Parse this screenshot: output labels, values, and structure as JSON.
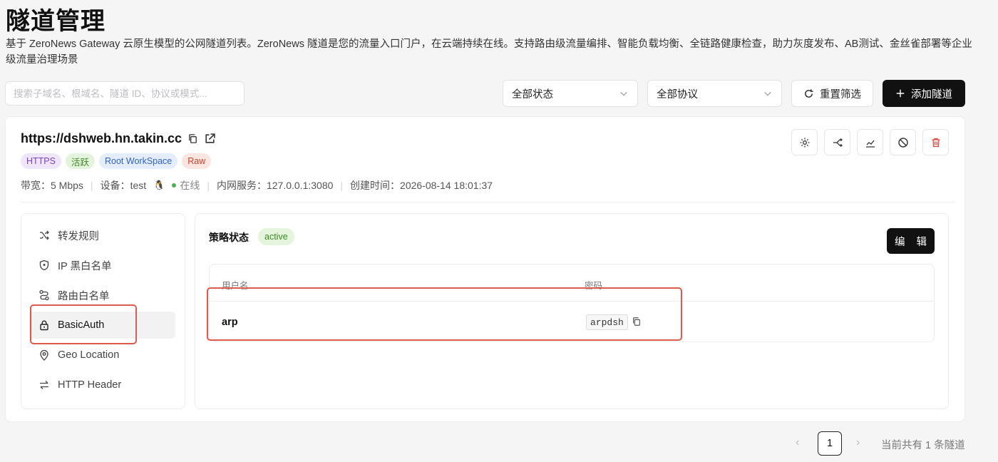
{
  "header": {
    "title": "隧道管理",
    "description": "基于 ZeroNews Gateway 云原生模型的公网隧道列表。ZeroNews 隧道是您的流量入口门户，在云端持续在线。支持路由级流量编排、智能负载均衡、全链路健康检查，助力灰度发布、AB测试、金丝雀部署等企业级流量治理场景"
  },
  "filters": {
    "search_placeholder": "搜索子域名、根域名、隧道 ID、协议或模式...",
    "status_select": "全部状态",
    "protocol_select": "全部协议",
    "reset_label": "重置筛选",
    "add_label": "添加隧道"
  },
  "tunnel": {
    "url": "https://dshweb.hn.takin.cc",
    "tags": [
      "HTTPS",
      "活跃",
      "Root WorkSpace",
      "Raw"
    ],
    "bandwidth_label": "带宽：",
    "bandwidth_value": "5 Mbps",
    "device_label": "设备：",
    "device_value": "test",
    "device_status": "在线",
    "internal_label": "内网服务：",
    "internal_value": "127.0.0.1:3080",
    "created_label": "创建时间：",
    "created_value": "2026-08-14 18:01:37"
  },
  "actions": [
    "settings-icon",
    "route-icon",
    "chart-icon",
    "disable-icon",
    "delete-icon"
  ],
  "sidebar": {
    "items": [
      {
        "label": "转发规则",
        "icon": "shuffle-icon"
      },
      {
        "label": "IP 黑白名单",
        "icon": "shield-icon"
      },
      {
        "label": "路由白名单",
        "icon": "route-icon"
      },
      {
        "label": "BasicAuth",
        "icon": "lock-icon"
      },
      {
        "label": "Geo Location",
        "icon": "location-icon"
      },
      {
        "label": "HTTP Header",
        "icon": "swap-icon"
      }
    ],
    "selected": "BasicAuth"
  },
  "policy": {
    "label": "策略状态",
    "status": "active",
    "edit_label": "编 辑"
  },
  "auth_table": {
    "headers": [
      "用户名",
      "密码"
    ],
    "rows": [
      {
        "username": "arp",
        "password": "arpdsh"
      }
    ]
  },
  "pagination": {
    "prev": "‹",
    "next": "›",
    "current_page": "1",
    "total_text": "当前共有 1 条隧道"
  },
  "colors": {
    "primary_button": "#111111",
    "status_green": "#3d8a25",
    "highlight_border": "#e05a4a"
  }
}
